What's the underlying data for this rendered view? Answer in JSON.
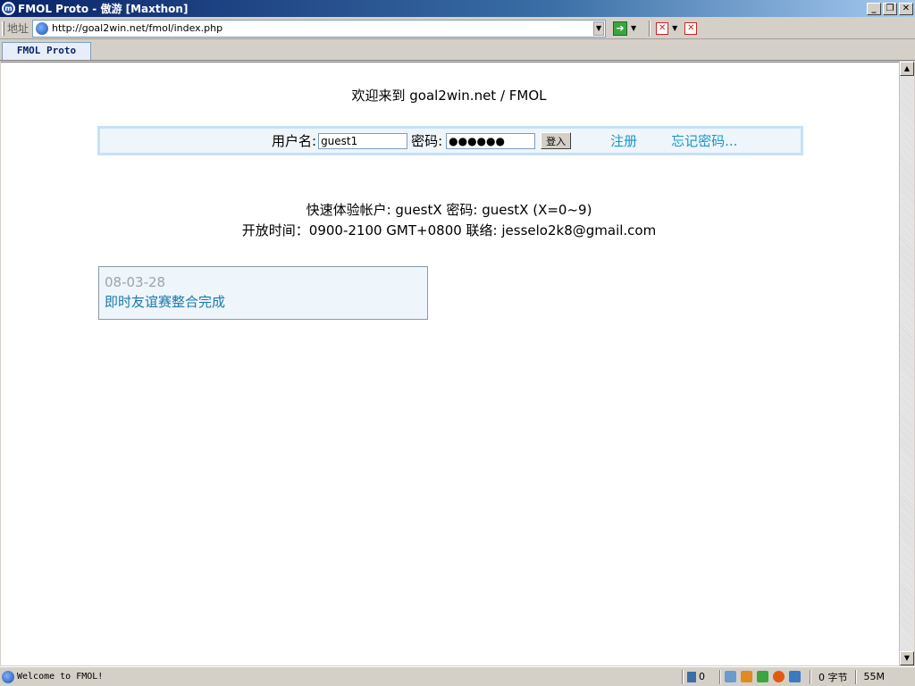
{
  "window": {
    "title": "FMOL Proto - 傲游 [Maxthon]"
  },
  "address": {
    "label": "地址",
    "url": "http://goal2win.net/fmol/index.php"
  },
  "tabs": [
    {
      "label": "FMOL Proto"
    }
  ],
  "page": {
    "welcome": "欢迎来到  goal2win.net / FMOL",
    "login": {
      "username_label": "用户名:",
      "username_value": "guest1",
      "password_label": "密码:",
      "password_value": "●●●●●●",
      "submit_label": "登入",
      "register_link": "注册",
      "forgot_link": "忘记密码..."
    },
    "quick_account": "快速体验帐户: guestX   密码: guestX (X=0~9)",
    "open_hours": "开放时间：0900-2100 GMT+0800   联络: jesselo2k8@gmail.com",
    "news": {
      "date": "08-03-28",
      "title": "即时友谊赛整合完成"
    }
  },
  "status": {
    "text": "Welcome to FMOL!",
    "trash_count": "0",
    "bytes": "0 字节",
    "memory": "55M"
  },
  "colors": {
    "link": "#1a96c8",
    "panel_bg": "#eef5fb",
    "panel_border": "#c6e1f5",
    "title_bar": "#0a246a"
  }
}
